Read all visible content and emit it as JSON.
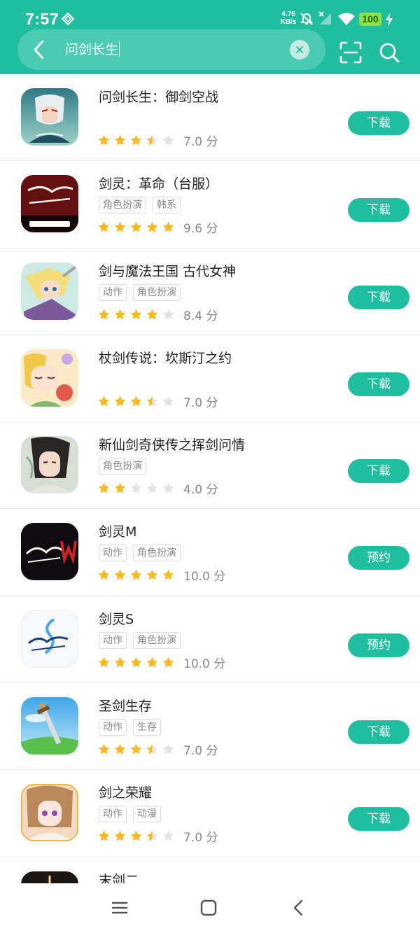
{
  "status_bar": {
    "time": "7:57",
    "net_speed_value": "4.76",
    "net_speed_unit": "KB/s",
    "battery": "100",
    "icons": [
      "app-notification-icon",
      "bell-off-icon",
      "signal-off-icon",
      "wifi-icon",
      "charging-icon"
    ]
  },
  "search": {
    "query": "问剑长生",
    "icons": [
      "back-arrow-icon",
      "clear-icon",
      "scan-icon",
      "search-icon"
    ]
  },
  "results": [
    {
      "name": "问剑长生：御剑空战",
      "tags": [],
      "rating": 3.5,
      "score": "7.0 分",
      "action": "下载",
      "icon": "game-wenjian-icon"
    },
    {
      "name": "剑灵：革命（台服）",
      "tags": [
        "角色扮演",
        "韩系"
      ],
      "rating": 5,
      "score": "9.6 分",
      "action": "下载",
      "icon": "game-bns-revolution-icon"
    },
    {
      "name": "剑与魔法王国 古代女神",
      "tags": [
        "动作",
        "角色扮演"
      ],
      "rating": 4,
      "score": "8.4 分",
      "action": "下载",
      "icon": "game-sword-magic-icon"
    },
    {
      "name": "杖剑传说：坎斯汀之约",
      "tags": [],
      "rating": 3.5,
      "score": "7.0 分",
      "action": "下载",
      "icon": "game-staff-sword-icon"
    },
    {
      "name": "新仙剑奇侠传之挥剑问情",
      "tags": [
        "角色扮演"
      ],
      "rating": 2,
      "score": "4.0 分",
      "action": "下载",
      "icon": "game-xianjian-icon"
    },
    {
      "name": "剑灵M",
      "tags": [
        "动作",
        "角色扮演"
      ],
      "rating": 5,
      "score": "10.0 分",
      "action": "预约",
      "icon": "game-bns-m-icon"
    },
    {
      "name": "剑灵S",
      "tags": [
        "动作",
        "角色扮演"
      ],
      "rating": 5,
      "score": "10.0 分",
      "action": "预约",
      "icon": "game-bns-s-icon"
    },
    {
      "name": "圣剑生存",
      "tags": [
        "动作",
        "生存"
      ],
      "rating": 3.5,
      "score": "7.0 分",
      "action": "下载",
      "icon": "game-holy-sword-icon"
    },
    {
      "name": "剑之荣耀",
      "tags": [
        "动作",
        "动漫"
      ],
      "rating": 3.5,
      "score": "7.0 分",
      "action": "下载",
      "icon": "game-sword-glory-icon"
    },
    {
      "name": "末剑二",
      "tags": [],
      "rating": 0,
      "score": "",
      "action": "",
      "icon": "game-mojian-icon"
    }
  ],
  "colors": {
    "accent": "#20bd9f",
    "star_on": "#f9b822",
    "star_off": "#e3e3e3",
    "tag_text": "#8a8a8a"
  },
  "nav_bar": {
    "icons": [
      "menu-icon",
      "home-icon",
      "back-icon"
    ]
  }
}
